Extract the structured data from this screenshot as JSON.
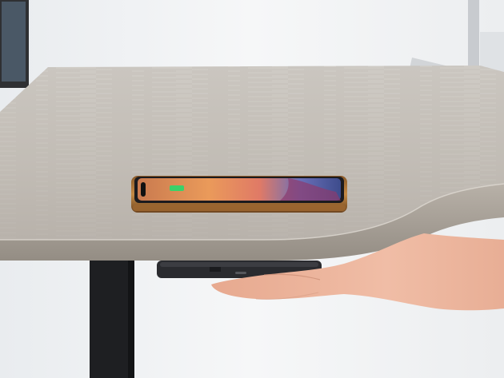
{
  "photo": {
    "subject": "",
    "colors": {
      "wall": "#f3f4f6",
      "desktop_top": "#c9c4bd",
      "desktop_edge": "#a39c93",
      "desk_leg": "#1e1f22",
      "phone_frame": "#b07a3e",
      "phone_screen_warm": "#e2825a",
      "phone_screen_cool": "#5d6fb4",
      "charger": "#2a2b2f",
      "skin": "#eab29a"
    }
  }
}
